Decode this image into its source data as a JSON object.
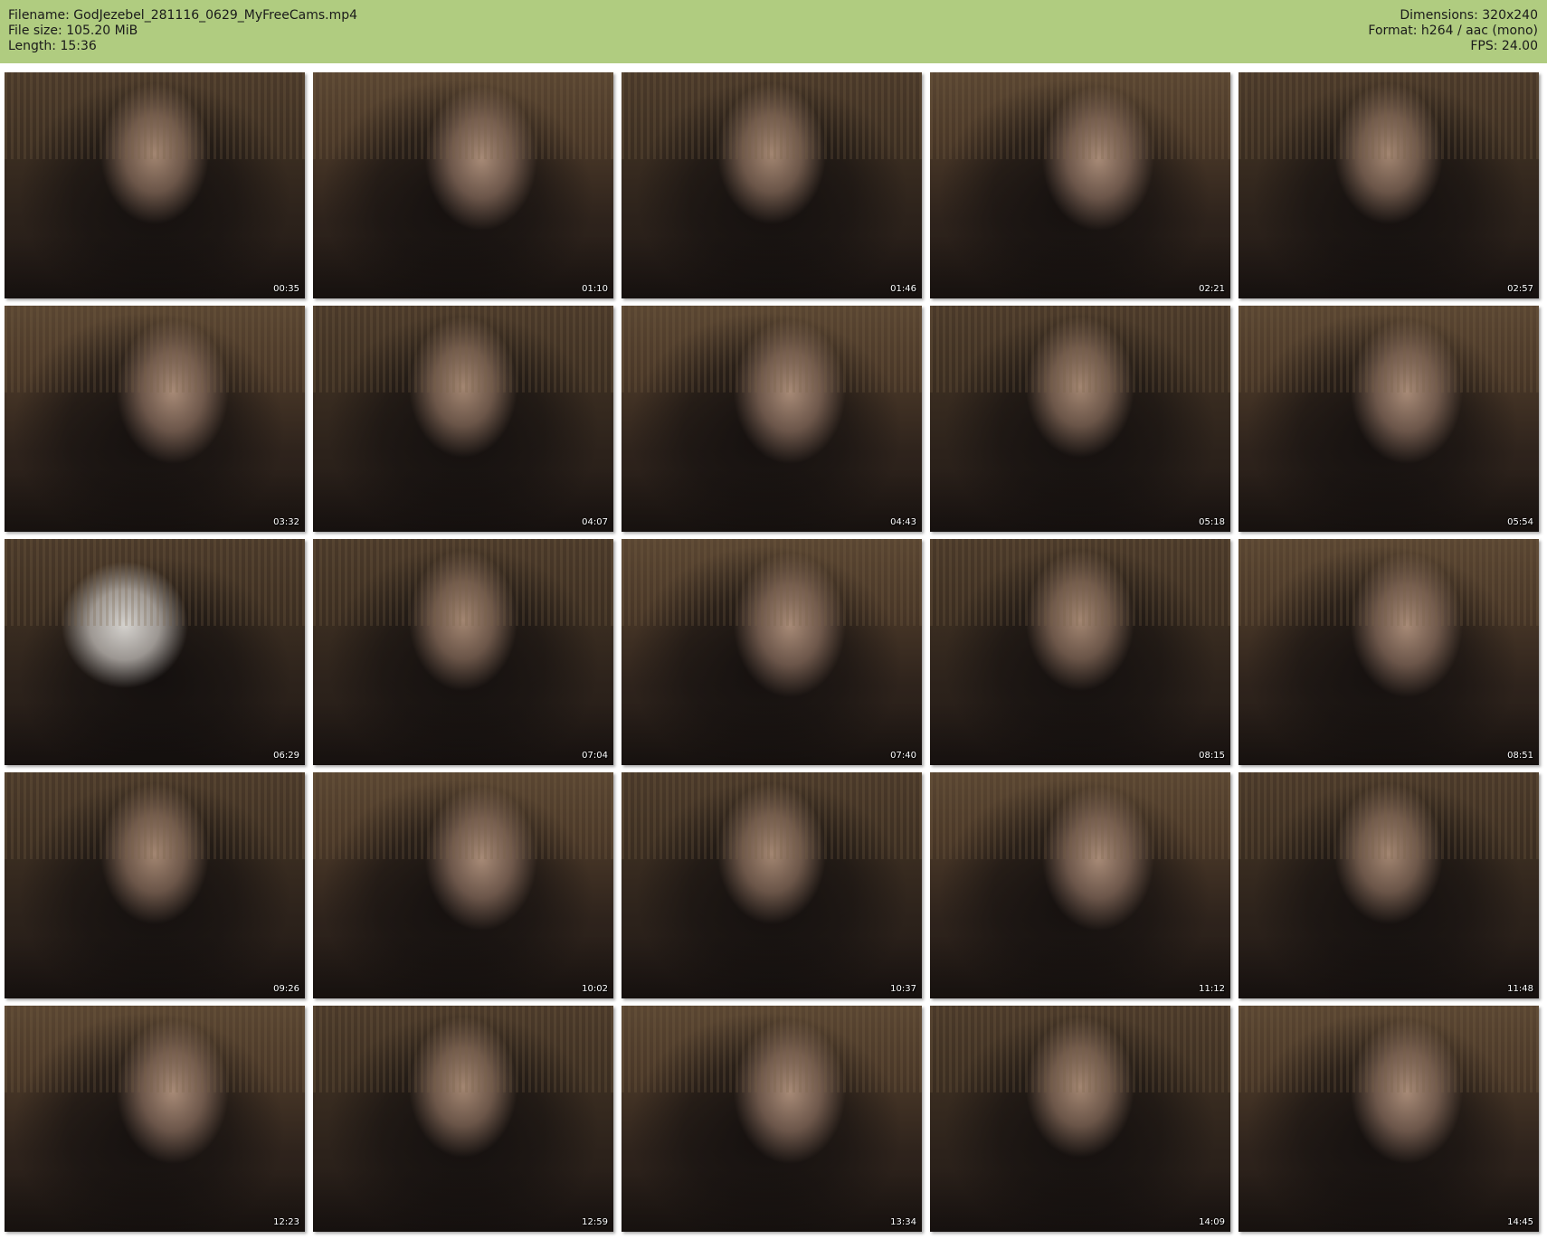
{
  "header": {
    "filename": "Filename: GodJezebel_281116_0629_MyFreeCams.mp4",
    "file_size": "File size: 105.20 MiB",
    "length": "Length: 15:36",
    "dimensions": "Dimensions: 320x240",
    "format": "Format: h264 / aac (mono)",
    "fps": "FPS: 24.00"
  },
  "thumbnails": [
    {
      "time": "00:35"
    },
    {
      "time": "01:10"
    },
    {
      "time": "01:46"
    },
    {
      "time": "02:21"
    },
    {
      "time": "02:57"
    },
    {
      "time": "03:32"
    },
    {
      "time": "04:07"
    },
    {
      "time": "04:43"
    },
    {
      "time": "05:18"
    },
    {
      "time": "05:54"
    },
    {
      "time": "06:29"
    },
    {
      "time": "07:04"
    },
    {
      "time": "07:40"
    },
    {
      "time": "08:15"
    },
    {
      "time": "08:51"
    },
    {
      "time": "09:26"
    },
    {
      "time": "10:02"
    },
    {
      "time": "10:37"
    },
    {
      "time": "11:12"
    },
    {
      "time": "11:48"
    },
    {
      "time": "12:23"
    },
    {
      "time": "12:59"
    },
    {
      "time": "13:34"
    },
    {
      "time": "14:09"
    },
    {
      "time": "14:45"
    }
  ]
}
